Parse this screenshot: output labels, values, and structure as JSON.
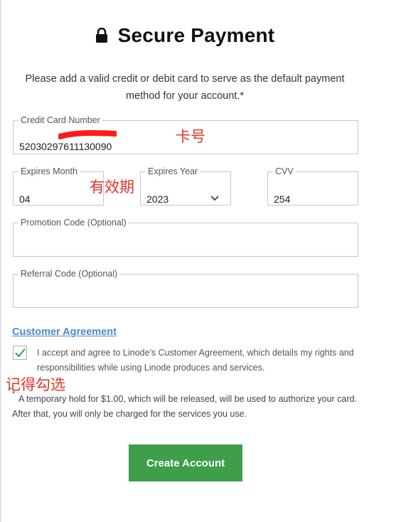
{
  "header": {
    "title": "Secure Payment",
    "icon": "lock-icon"
  },
  "intro_text": "Please add a valid credit or debit card to serve as the default payment method for your account.*",
  "form": {
    "card_number": {
      "label": "Credit Card Number",
      "value": "52030297611130090"
    },
    "expires_month": {
      "label": "Expires Month",
      "value": "04"
    },
    "expires_year": {
      "label": "Expires Year",
      "value": "2023"
    },
    "cvv": {
      "label": "CVV",
      "value": "254"
    },
    "promotion_code": {
      "label": "Promotion Code (Optional)",
      "value": ""
    },
    "referral_code": {
      "label": "Referral Code (Optional)",
      "value": ""
    }
  },
  "agreement": {
    "link_label": "Customer Agreement",
    "checked": true,
    "text": "I accept and agree to Linode's Customer Agreement, which details my rights and responsibilities while using Linode produces and services."
  },
  "footnote": {
    "marker": "*",
    "text": "A temporary hold for $1.00, which will be released, will be used to authorize your card. After that, you will only be charged for the services you use."
  },
  "submit_label": "Create Account",
  "annotations": {
    "card_number": "卡号",
    "expiry": "有效期",
    "checkbox": "记得勾选",
    "color": "#e0362c"
  },
  "colors": {
    "primary_button": "#3f9e4a",
    "link": "#4a8cc6",
    "checkmark": "#3f9e4a"
  }
}
